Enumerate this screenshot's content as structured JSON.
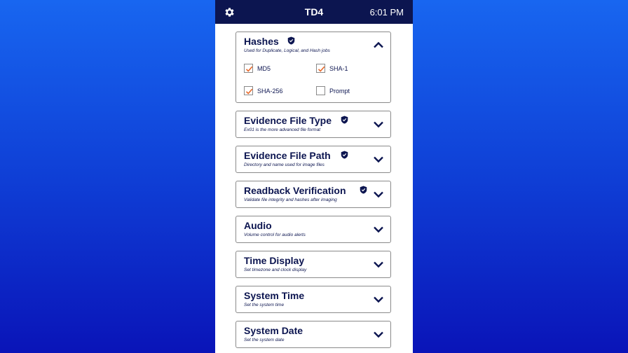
{
  "header": {
    "title": "TD4",
    "time": "6:01 PM"
  },
  "hashes": {
    "title": "Hashes",
    "description": "Used for Duplicate, Logical, and Hash jobs",
    "options": [
      {
        "label": "MD5",
        "checked": true
      },
      {
        "label": "SHA-1",
        "checked": true
      },
      {
        "label": "SHA-256",
        "checked": true
      },
      {
        "label": "Prompt",
        "checked": false
      }
    ]
  },
  "sections": [
    {
      "title": "Evidence File Type",
      "description": "Ex01 is the more advanced file format",
      "shield": true
    },
    {
      "title": "Evidence File Path",
      "description": "Directory and name used for image files",
      "shield": true
    },
    {
      "title": "Readback Verification",
      "description": "Validate file integrity and hashes after imaging",
      "shield": true
    },
    {
      "title": "Audio",
      "description": "Volume control for audio alerts",
      "shield": false
    },
    {
      "title": "Time Display",
      "description": "Set timezone and clock display",
      "shield": false
    },
    {
      "title": "System Time",
      "description": "Set the system time",
      "shield": false
    },
    {
      "title": "System Date",
      "description": "Set the system date",
      "shield": false
    }
  ],
  "colors": {
    "navy": "#0c1550",
    "check": "#e8692a",
    "background_top": "#1866f0",
    "background_bottom": "#0a14b8"
  }
}
